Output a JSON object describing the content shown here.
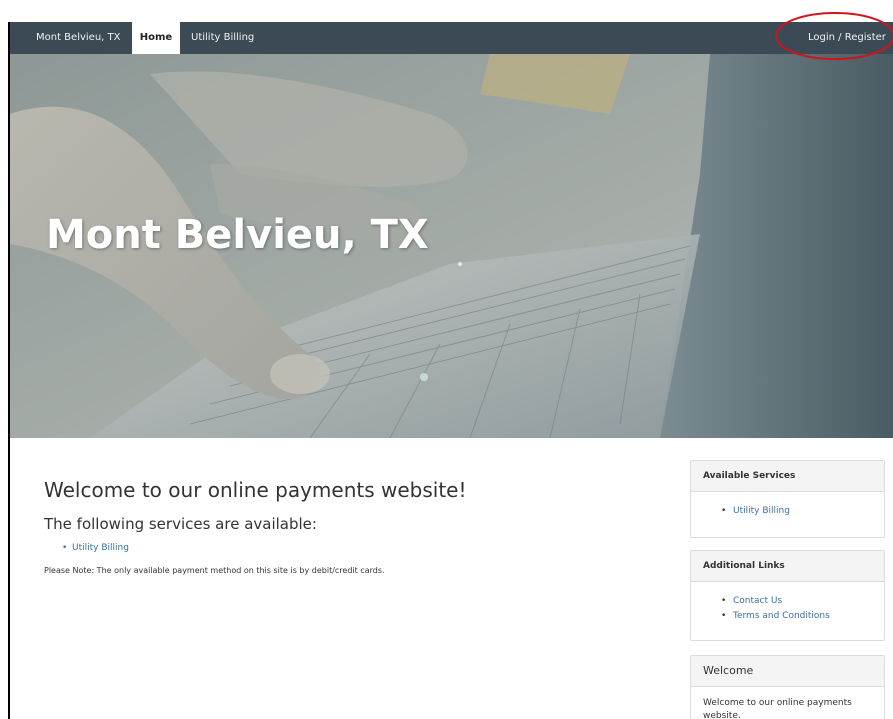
{
  "navbar": {
    "brand": "Mont Belvieu, TX",
    "items": [
      {
        "label": "Home",
        "active": true
      },
      {
        "label": "Utility Billing",
        "active": false
      }
    ],
    "login_label": "Login / Register",
    "background_color": "#3b4a54"
  },
  "hero": {
    "title": "Mont Belvieu, TX"
  },
  "main": {
    "heading": "Welcome to our online payments website!",
    "subheading": "The following services are available:",
    "services": [
      "Utility Billing"
    ],
    "note": "Please Note:  The only available payment method on this site is by debit/credit cards."
  },
  "sidebar": {
    "available_services": {
      "title": "Available Services",
      "items": [
        "Utility Billing"
      ]
    },
    "additional_links": {
      "title": "Additional Links",
      "items": [
        "Contact Us",
        "Terms and Conditions"
      ]
    },
    "welcome": {
      "title": "Welcome",
      "text": "Welcome to our online payments website."
    }
  },
  "colors": {
    "link": "#3a6ea5",
    "annotation": "#d0141c"
  }
}
